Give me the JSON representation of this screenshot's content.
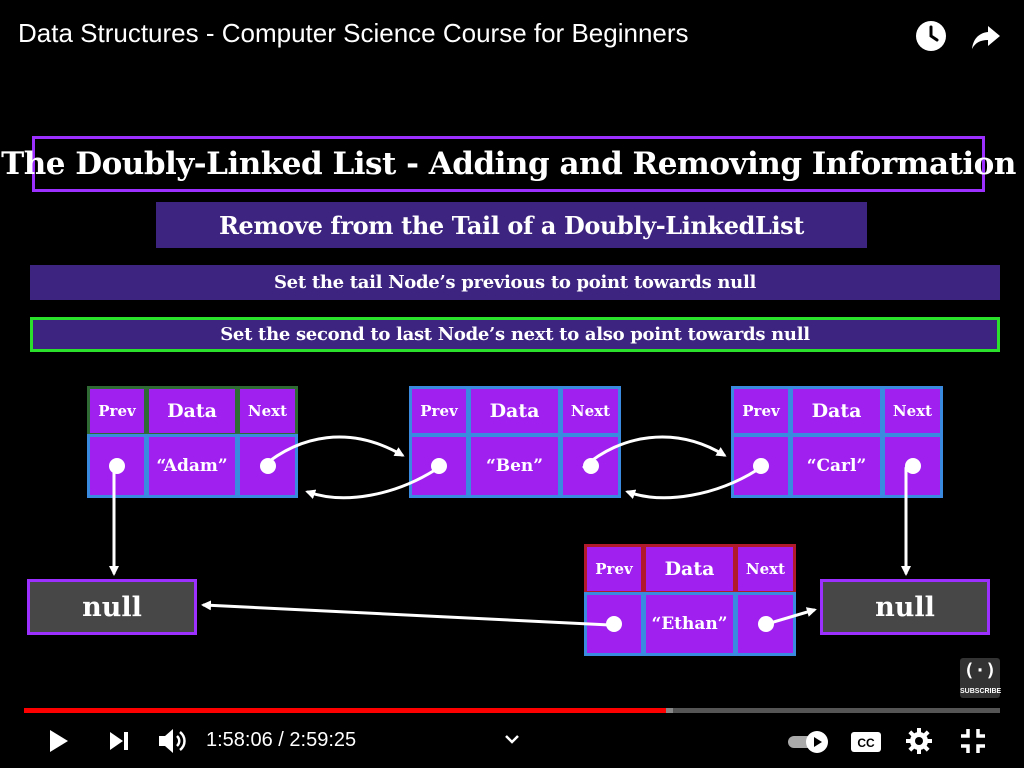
{
  "video": {
    "title": "Data Structures - Computer Science Course for Beginners"
  },
  "icons": {
    "watch_later": "clock-icon",
    "share": "share-arrow-icon",
    "play": "play-icon",
    "next": "skip-next-icon",
    "volume": "volume-icon",
    "chevron": "chevron-down-icon",
    "autoplay": "autoplay-toggle-icon",
    "captions": "cc-icon",
    "settings": "gear-icon",
    "exit_fullscreen": "exit-fullscreen-icon"
  },
  "slide": {
    "title": "The Doubly-Linked List - Adding and Removing Information",
    "subtitle": "Remove from the Tail of a Doubly-LinkedList",
    "steps": [
      "Set the tail Node’s previous to point towards null",
      "Set the second to last Node’s next to also point towards null"
    ],
    "headers": {
      "prev": "Prev",
      "data": "Data",
      "next": "Next"
    },
    "nodes": [
      {
        "value": "“Adam”"
      },
      {
        "value": "“Ben”"
      },
      {
        "value": "“Carl”"
      },
      {
        "value": "“Ethan”"
      }
    ],
    "null_left": "null",
    "null_right": "null"
  },
  "channel": {
    "logo_glyph": "(·)",
    "subscribe_label": "SUBSCRIBE"
  },
  "player": {
    "current_time": "1:58:06",
    "duration": "2:59:25",
    "time_display": "1:58:06 / 2:59:25",
    "progress_fraction": 0.658,
    "buffered_fraction": 0.665
  },
  "colors": {
    "slide_purple": "#a020f0",
    "banner_purple": "#3d2480",
    "cell_border_blue": "#3a8be0",
    "highlight_green": "#2be02b",
    "progress_red": "#ff0000",
    "null_grey": "#474747"
  }
}
